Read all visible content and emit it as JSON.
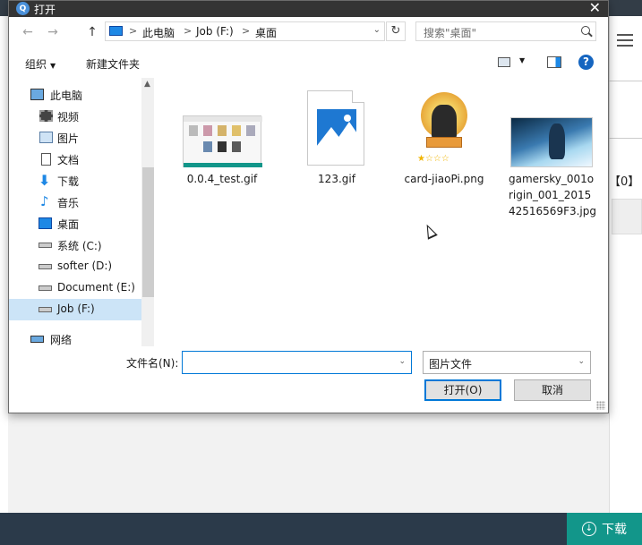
{
  "dialog": {
    "title": "打开",
    "close_glyph": "✕"
  },
  "nav_buttons": {
    "back": "←",
    "forward": "→",
    "up": "↑"
  },
  "address": {
    "crumbs": [
      "此电脑",
      "Job (F:)",
      "桌面"
    ],
    "separator": ">",
    "dropdown_glyph": "⌄",
    "refresh_glyph": "↻"
  },
  "search": {
    "placeholder": "搜索\"桌面\""
  },
  "toolbar": {
    "organize_label": "组织",
    "new_folder_label": "新建文件夹",
    "help_label": "?"
  },
  "sidebar": {
    "items": [
      {
        "label": "此电脑",
        "icon": "computer-icon",
        "selected": false
      },
      {
        "label": "视频",
        "icon": "video-icon",
        "selected": false
      },
      {
        "label": "图片",
        "icon": "pictures-icon",
        "selected": false
      },
      {
        "label": "文档",
        "icon": "documents-icon",
        "selected": false
      },
      {
        "label": "下载",
        "icon": "download-icon",
        "selected": false
      },
      {
        "label": "音乐",
        "icon": "music-icon",
        "selected": false
      },
      {
        "label": "桌面",
        "icon": "desktop-icon",
        "selected": false
      },
      {
        "label": "系统 (C:)",
        "icon": "drive-icon",
        "selected": false
      },
      {
        "label": "softer (D:)",
        "icon": "drive-icon",
        "selected": false
      },
      {
        "label": "Document (E:)",
        "icon": "drive-icon",
        "selected": false
      },
      {
        "label": "Job (F:)",
        "icon": "drive-icon",
        "selected": true
      },
      {
        "label": "网络",
        "icon": "network-icon",
        "selected": false
      }
    ]
  },
  "files": [
    {
      "name": "0.0.4_test.gif",
      "kind": "screenshot-thumbnail"
    },
    {
      "name": "123.gif",
      "kind": "image-file-icon"
    },
    {
      "name": "card-jiaoPi.png",
      "kind": "card-thumbnail"
    },
    {
      "name": "gamersky_001origin_001_201542516569F3.jpg",
      "kind": "game-art-thumbnail"
    }
  ],
  "footer": {
    "filename_label": "文件名(N):",
    "filename_value": "",
    "filetype_value": "图片文件",
    "open_label": "打开(O)",
    "cancel_label": "取消"
  },
  "background_app": {
    "count_text": "【0】",
    "download_label": "下载"
  },
  "colors": {
    "titlebar": "#343434",
    "accent": "#0078d7",
    "download_button": "#12968a",
    "app_bar": "#2b3a4a"
  }
}
